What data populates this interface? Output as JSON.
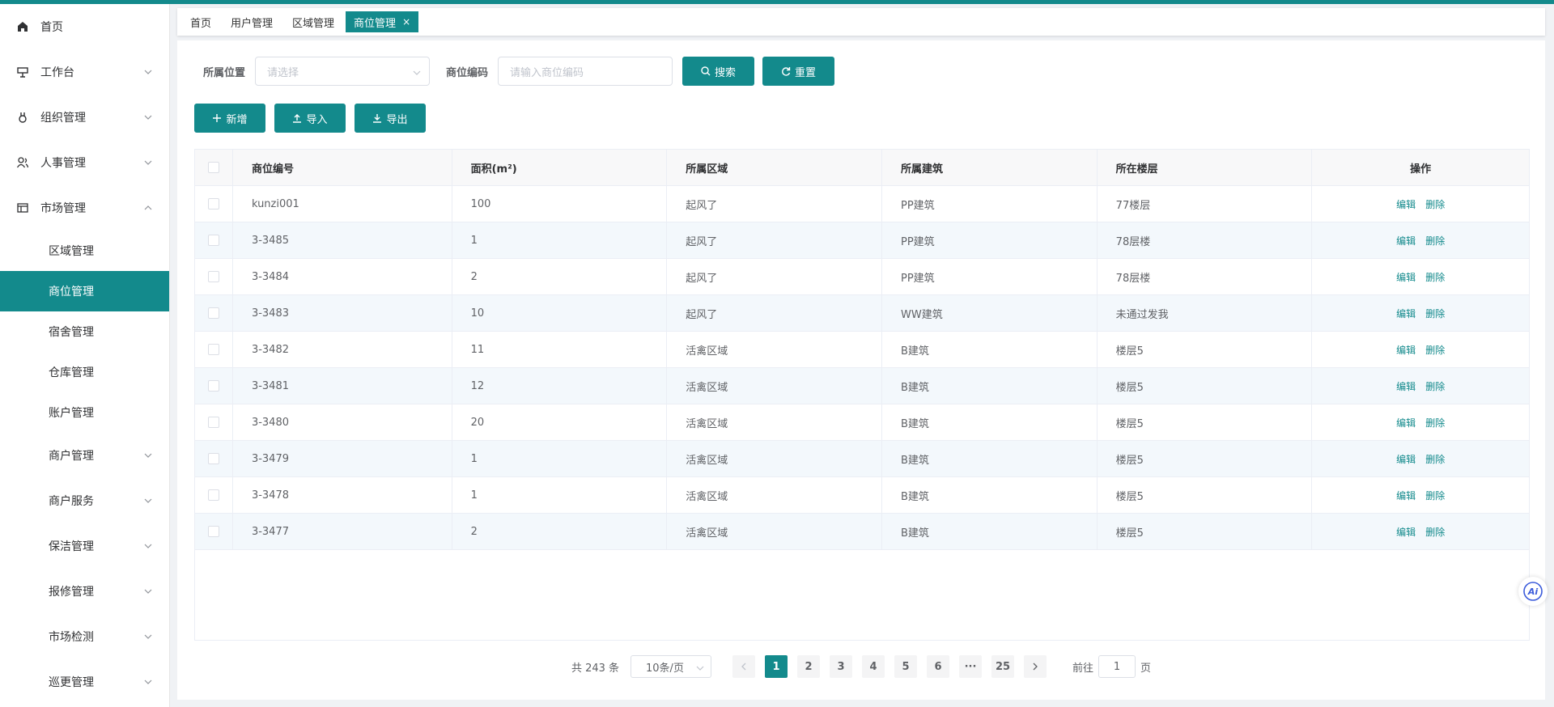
{
  "sidebar": {
    "items": [
      {
        "label": "首页",
        "icon": "home-icon"
      },
      {
        "label": "工作台",
        "icon": "workbench-icon",
        "expandable": true
      },
      {
        "label": "组织管理",
        "icon": "medal-icon",
        "expandable": true
      },
      {
        "label": "人事管理",
        "icon": "users-icon",
        "expandable": true
      },
      {
        "label": "市场管理",
        "icon": "market-icon",
        "expanded": true
      }
    ],
    "market_sub": [
      "区域管理",
      "商位管理",
      "宿舍管理",
      "仓库管理",
      "账户管理"
    ],
    "market_sub_active": "商位管理",
    "more": [
      "商户管理",
      "商户服务",
      "保洁管理",
      "报修管理",
      "市场检测",
      "巡更管理"
    ]
  },
  "tabs": [
    {
      "label": "首页"
    },
    {
      "label": "用户管理"
    },
    {
      "label": "区域管理"
    },
    {
      "label": "商位管理",
      "active": true,
      "close": "×"
    }
  ],
  "filters": {
    "location_label": "所属位置",
    "location_placeholder": "请选择",
    "code_label": "商位编码",
    "code_placeholder": "请输入商位编码",
    "search_label": "搜索",
    "reset_label": "重置"
  },
  "actions": {
    "add_label": "新增",
    "import_label": "导入",
    "export_label": "导出"
  },
  "table": {
    "columns": [
      "商位编号",
      "面积(m²)",
      "所属区域",
      "所属建筑",
      "所在楼层",
      "操作"
    ],
    "edit_label": "编辑",
    "delete_label": "删除",
    "rows": [
      [
        "kunzi001",
        "100",
        "起风了",
        "PP建筑",
        "77楼层"
      ],
      [
        "3-3485",
        "1",
        "起风了",
        "PP建筑",
        "78层楼"
      ],
      [
        "3-3484",
        "2",
        "起风了",
        "PP建筑",
        "78层楼"
      ],
      [
        "3-3483",
        "10",
        "起风了",
        "WW建筑",
        "未通过发我"
      ],
      [
        "3-3482",
        "11",
        "活禽区域",
        "B建筑",
        "楼层5"
      ],
      [
        "3-3481",
        "12",
        "活禽区域",
        "B建筑",
        "楼层5"
      ],
      [
        "3-3480",
        "20",
        "活禽区域",
        "B建筑",
        "楼层5"
      ],
      [
        "3-3479",
        "1",
        "活禽区域",
        "B建筑",
        "楼层5"
      ],
      [
        "3-3478",
        "1",
        "活禽区域",
        "B建筑",
        "楼层5"
      ],
      [
        "3-3477",
        "2",
        "活禽区域",
        "B建筑",
        "楼层5"
      ]
    ]
  },
  "pagination": {
    "total": "共 243 条",
    "page_size": "10条/页",
    "pages": [
      "1",
      "2",
      "3",
      "4",
      "5",
      "6",
      "···",
      "25"
    ],
    "current": "1",
    "goto_label": "前往",
    "goto_value": "1",
    "goto_suffix": "页"
  },
  "ai_badge": "Ai",
  "colors": {
    "primary": "#138a8c",
    "striped_row": "#f3f8fc"
  }
}
